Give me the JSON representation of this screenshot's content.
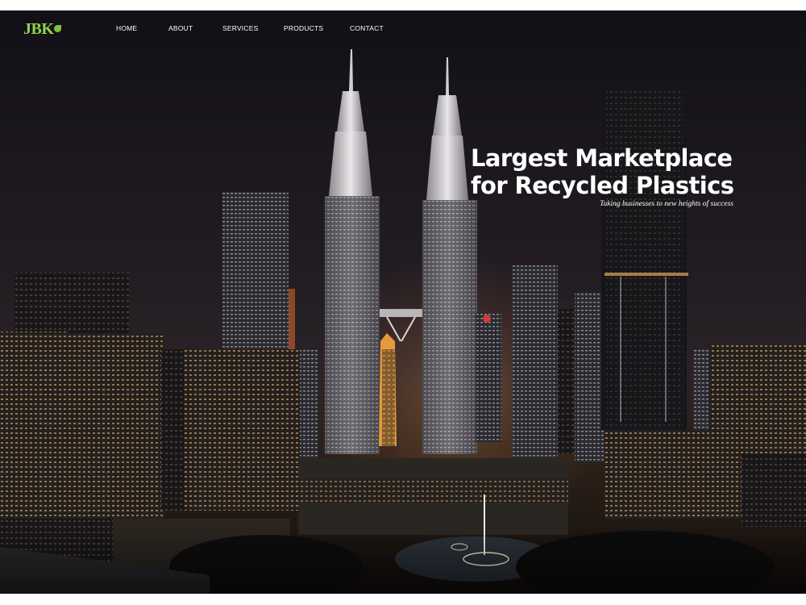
{
  "brand": {
    "logo_text": "JBK"
  },
  "nav": {
    "items": [
      {
        "label": "HOME"
      },
      {
        "label": "ABOUT"
      },
      {
        "label": "SERVICES"
      },
      {
        "label": "PRODUCTS"
      },
      {
        "label": "CONTACT"
      }
    ]
  },
  "hero": {
    "headline_line1": "Largest Marketplace",
    "headline_line2": "for Recycled Plastics",
    "tagline": "Taking businesses to new heights of success"
  },
  "colors": {
    "logo_green": "#8fd14f",
    "nav_text": "#ffffff",
    "headline": "#ffffff"
  }
}
